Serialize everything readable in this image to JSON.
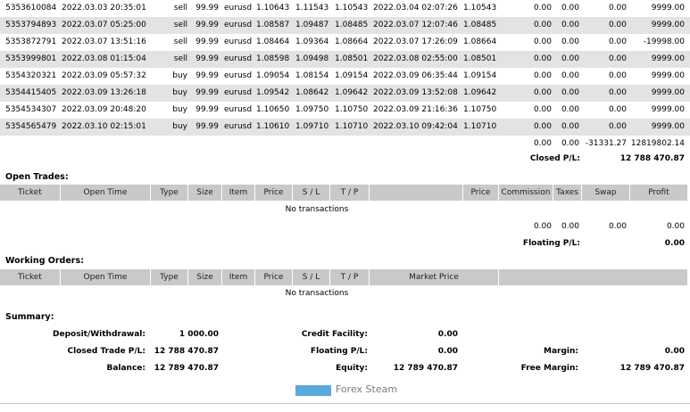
{
  "closed_rows": [
    {
      "ticket": "5353610084",
      "open_time": "2022.03.03 20:35:01",
      "type": "sell",
      "size": "99.99",
      "item": "eurusd",
      "price": "1.10643",
      "sl": "1.11543",
      "tp": "1.10543",
      "close_time": "2022.03.04 02:07:26",
      "close_price": "1.10543",
      "commission": "0.00",
      "taxes": "0.00",
      "swap": "0.00",
      "profit": "9999.00"
    },
    {
      "ticket": "5353794893",
      "open_time": "2022.03.07 05:25:00",
      "type": "sell",
      "size": "99.99",
      "item": "eurusd",
      "price": "1.08587",
      "sl": "1.09487",
      "tp": "1.08485",
      "close_time": "2022.03.07 12:07:46",
      "close_price": "1.08485",
      "commission": "0.00",
      "taxes": "0.00",
      "swap": "0.00",
      "profit": "9999.00"
    },
    {
      "ticket": "5353872791",
      "open_time": "2022.03.07 13:51:16",
      "type": "sell",
      "size": "99.99",
      "item": "eurusd",
      "price": "1.08464",
      "sl": "1.09364",
      "tp": "1.08664",
      "close_time": "2022.03.07 17:26:09",
      "close_price": "1.08664",
      "commission": "0.00",
      "taxes": "0.00",
      "swap": "0.00",
      "profit": "-19998.00"
    },
    {
      "ticket": "5353999801",
      "open_time": "2022.03.08 01:15:04",
      "type": "sell",
      "size": "99.99",
      "item": "eurusd",
      "price": "1.08598",
      "sl": "1.09498",
      "tp": "1.08501",
      "close_time": "2022.03.08 02:55:00",
      "close_price": "1.08501",
      "commission": "0.00",
      "taxes": "0.00",
      "swap": "0.00",
      "profit": "9999.00"
    },
    {
      "ticket": "5354320321",
      "open_time": "2022.03.09 05:57:32",
      "type": "buy",
      "size": "99.99",
      "item": "eurusd",
      "price": "1.09054",
      "sl": "1.08154",
      "tp": "1.09154",
      "close_time": "2022.03.09 06:35:44",
      "close_price": "1.09154",
      "commission": "0.00",
      "taxes": "0.00",
      "swap": "0.00",
      "profit": "9999.00"
    },
    {
      "ticket": "5354415405",
      "open_time": "2022.03.09 13:26:18",
      "type": "buy",
      "size": "99.99",
      "item": "eurusd",
      "price": "1.09542",
      "sl": "1.08642",
      "tp": "1.09642",
      "close_time": "2022.03.09 13:52:08",
      "close_price": "1.09642",
      "commission": "0.00",
      "taxes": "0.00",
      "swap": "0.00",
      "profit": "9999.00"
    },
    {
      "ticket": "5354534307",
      "open_time": "2022.03.09 20:48:20",
      "type": "buy",
      "size": "99.99",
      "item": "eurusd",
      "price": "1.10650",
      "sl": "1.09750",
      "tp": "1.10750",
      "close_time": "2022.03.09 21:16:36",
      "close_price": "1.10750",
      "commission": "0.00",
      "taxes": "0.00",
      "swap": "0.00",
      "profit": "9999.00"
    },
    {
      "ticket": "5354565479",
      "open_time": "2022.03.10 02:15:01",
      "type": "buy",
      "size": "99.99",
      "item": "eurusd",
      "price": "1.10610",
      "sl": "1.09710",
      "tp": "1.10710",
      "close_time": "2022.03.10 09:42:04",
      "close_price": "1.10710",
      "commission": "0.00",
      "taxes": "0.00",
      "swap": "0.00",
      "profit": "9999.00"
    }
  ],
  "closed_totals": {
    "commission": "0.00",
    "taxes": "0.00",
    "swap": "-31331.27",
    "profit": "12819802.14"
  },
  "closed_pl": {
    "label": "Closed P/L:",
    "value": "12 788 470.87"
  },
  "open_trades": {
    "title": "Open Trades:",
    "headers": [
      "Ticket",
      "Open Time",
      "Type",
      "Size",
      "Item",
      "Price",
      "S / L",
      "T / P",
      "",
      "Price",
      "Commission",
      "Taxes",
      "Swap",
      "Profit"
    ],
    "empty": "No transactions",
    "totals": {
      "commission": "0.00",
      "taxes": "0.00",
      "swap": "0.00",
      "profit": "0.00"
    },
    "floating_label": "Floating P/L:",
    "floating_value": "0.00"
  },
  "working_orders": {
    "title": "Working Orders:",
    "headers": [
      "Ticket",
      "Open Time",
      "Type",
      "Size",
      "Item",
      "Price",
      "S / L",
      "T / P",
      "Market Price"
    ],
    "empty": "No transactions"
  },
  "summary": {
    "title": "Summary:",
    "deposit_label": "Deposit/Withdrawal:",
    "deposit_value": "1 000.00",
    "credit_label": "Credit Facility:",
    "credit_value": "0.00",
    "closed_label": "Closed Trade P/L:",
    "closed_value": "12 788 470.87",
    "floating_label": "Floating P/L:",
    "floating_value": "0.00",
    "margin_label": "Margin:",
    "margin_value": "0.00",
    "balance_label": "Balance:",
    "balance_value": "12 789 470.87",
    "equity_label": "Equity:",
    "equity_value": "12 789 470.87",
    "free_margin_label": "Free Margin:",
    "free_margin_value": "12 789 470.87"
  },
  "legend": {
    "label": "Forex Steam",
    "color": "#5aa9dd"
  }
}
